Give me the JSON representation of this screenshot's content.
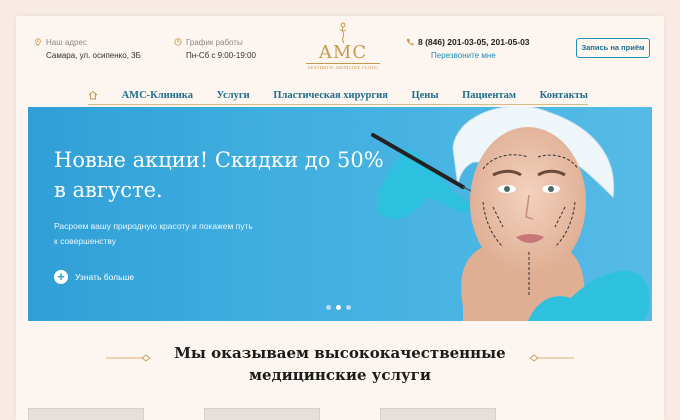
{
  "header": {
    "address_label": "Наш адрес",
    "address_value": "Самара, ул. осипенко, 3Б",
    "schedule_label": "График работы",
    "schedule_value": "Пн-Сб с 9:00-19:00",
    "logo_text": "AMC",
    "logo_sub": "AESTHETIC MEDICINE CLINIC",
    "phones": "8 (846) 201-03-05,  201-05-03",
    "callback_label": "Перезвоните мне",
    "cta_label": "Запись на приём"
  },
  "nav": {
    "items": [
      "AMC-Клиника",
      "Услуги",
      "Пластическая хирургия",
      "Цены",
      "Пациентам",
      "Контакты"
    ]
  },
  "hero": {
    "title": "Новые акции! Скидки до 50% в августе.",
    "subtitle": "Расроем вашу природную красоту и покажем путь к совершенству",
    "more_label": "Узнать больше",
    "slides": 3,
    "active_slide": 2
  },
  "section": {
    "title": "Мы оказываем высококачественные медицинские услуги"
  },
  "colors": {
    "accent_blue": "#1e8fb5",
    "gold": "#c9974e",
    "hero_blue": "#40aee0"
  }
}
